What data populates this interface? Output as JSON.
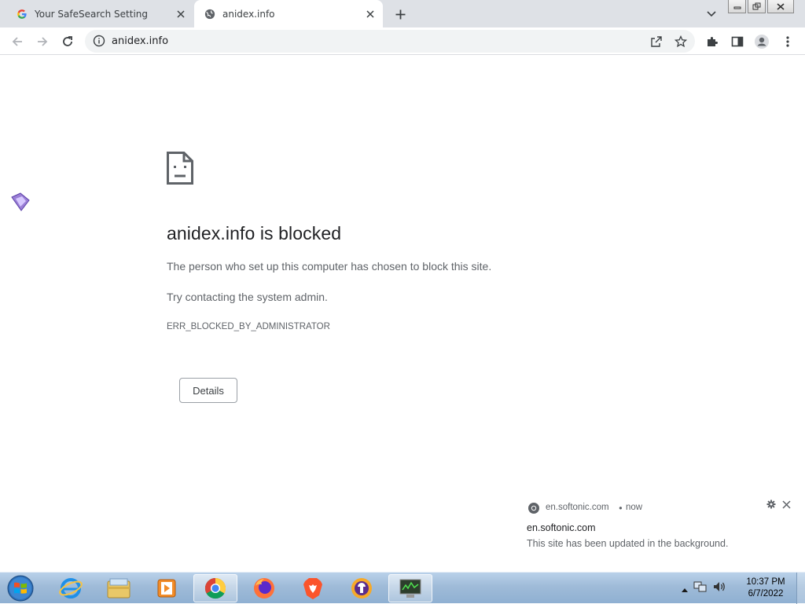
{
  "browser": {
    "tabs": [
      {
        "title": "Your SafeSearch Setting",
        "favicon": "google-g-icon",
        "active": false
      },
      {
        "title": "anidex.info",
        "favicon": "globe-icon",
        "active": true
      }
    ],
    "address": {
      "url": "anidex.info"
    }
  },
  "error_page": {
    "title": "anidex.info is blocked",
    "message": "The person who set up this computer has chosen to block this site.",
    "suggestion": "Try contacting the system admin.",
    "error_code": "ERR_BLOCKED_BY_ADMINISTRATOR",
    "details_button": "Details"
  },
  "notification": {
    "source": "en.softonic.com",
    "separator": "•",
    "time": "now",
    "title": "en.softonic.com",
    "body": "This site has been updated in the background."
  },
  "taskbar": {
    "apps": [
      "internet-explorer-icon",
      "file-explorer-icon",
      "media-player-icon",
      "chrome-icon",
      "firefox-icon",
      "brave-icon",
      "vpn-shield-icon",
      "system-monitor-icon"
    ],
    "clock_time": "10:37 PM",
    "clock_date": "6/7/2022"
  },
  "colors": {
    "tab_strip": "#dee1e6",
    "omnibox": "#f1f3f4",
    "taskbar": "#9fbbd8",
    "text_primary": "#202124",
    "text_secondary": "#5f6368"
  }
}
